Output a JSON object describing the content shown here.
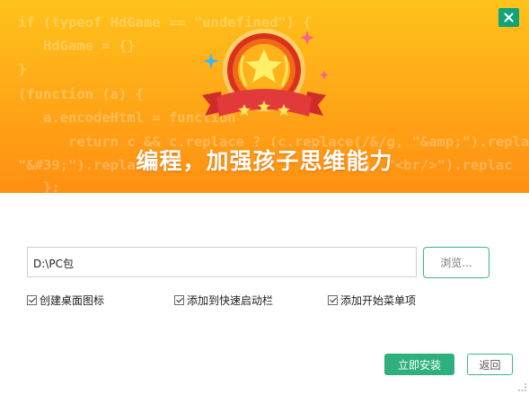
{
  "window": {
    "close_icon": "close-icon",
    "accent_color": "#2eb07e"
  },
  "banner": {
    "code_lines": [
      "if (typeof HdGame == \"undefined\") {",
      "   HdGame = {}",
      "}",
      "(function (a) {",
      "   a.encodeHtml = function",
      "      return c && c.replace ? (c.replace(/&/g, \"&amp;\").replace(/",
      "\"&#39;\").replac",
      "                                         g, \"<br/>\").replac",
      "   };"
    ],
    "slogan": "编程，加强孩子思维能力",
    "emblem_icon": "star-medal-icon",
    "gradient_top": "#ffc21a",
    "gradient_bottom": "#ff8f12"
  },
  "install": {
    "path_value": "D:\\PC包",
    "browse_label": "浏览...",
    "options": [
      {
        "label": "创建桌面图标",
        "checked": true
      },
      {
        "label": "添加到快速启动栏",
        "checked": true
      },
      {
        "label": "添加开始菜单项",
        "checked": true
      }
    ],
    "install_label": "立即安装",
    "back_label": "返回"
  }
}
